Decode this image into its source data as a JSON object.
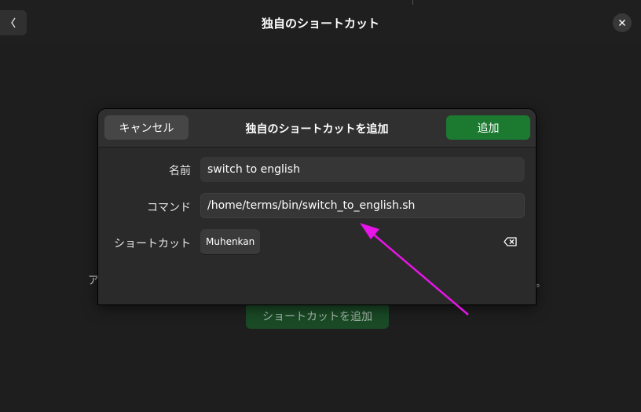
{
  "window": {
    "title": "独自のショートカット",
    "back_icon": "chevron-left-icon",
    "close_icon": "close-icon"
  },
  "background": {
    "partial_left_text": "ア",
    "partial_right_text": "。",
    "add_shortcut_label": "ショートカットを追加"
  },
  "dialog": {
    "title": "独自のショートカットを追加",
    "cancel_label": "キャンセル",
    "add_label": "追加",
    "fields": {
      "name_label": "名前",
      "name_value": "switch to english",
      "command_label": "コマンド",
      "command_value": "/home/terms/bin/switch_to_english.sh",
      "shortcut_label": "ショートカット",
      "shortcut_value": "Muhenkan",
      "clear_icon": "backspace-clear-icon"
    }
  },
  "annotation": {
    "arrow_color": "#e815e8"
  },
  "colors": {
    "accent_green": "#1b7a2f",
    "window_bg": "#1e1e1e",
    "dialog_bg": "#2a2a2a"
  }
}
